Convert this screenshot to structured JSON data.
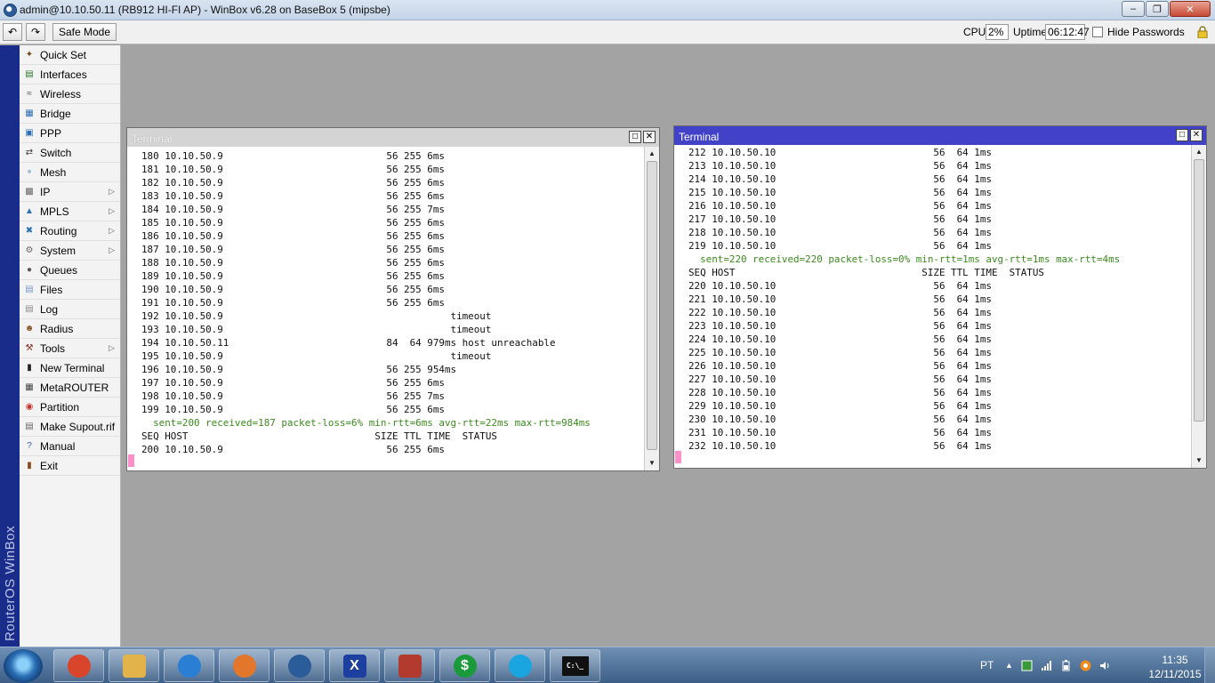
{
  "window": {
    "title": "admin@10.10.50.11 (RB912 HI-FI AP) - WinBox v6.28 on BaseBox 5 (mipsbe)"
  },
  "toolbar": {
    "safe_mode_label": "Safe Mode",
    "cpu_label": "CPU:",
    "cpu_value": "2%",
    "uptime_label": "Uptime:",
    "uptime_value": "06:12:47",
    "hide_passwords_label": "Hide Passwords"
  },
  "brand": "RouterOS WinBox",
  "menu": [
    {
      "label": "Quick Set",
      "icon": "wand-icon",
      "submenu": false
    },
    {
      "label": "Interfaces",
      "icon": "interfaces-icon",
      "submenu": false
    },
    {
      "label": "Wireless",
      "icon": "wireless-icon",
      "submenu": false
    },
    {
      "label": "Bridge",
      "icon": "bridge-icon",
      "submenu": false
    },
    {
      "label": "PPP",
      "icon": "ppp-icon",
      "submenu": false
    },
    {
      "label": "Switch",
      "icon": "switch-icon",
      "submenu": false
    },
    {
      "label": "Mesh",
      "icon": "mesh-icon",
      "submenu": false
    },
    {
      "label": "IP",
      "icon": "ip-icon",
      "submenu": true
    },
    {
      "label": "MPLS",
      "icon": "mpls-icon",
      "submenu": true
    },
    {
      "label": "Routing",
      "icon": "routing-icon",
      "submenu": true
    },
    {
      "label": "System",
      "icon": "gear-icon",
      "submenu": true
    },
    {
      "label": "Queues",
      "icon": "queues-icon",
      "submenu": false
    },
    {
      "label": "Files",
      "icon": "folder-icon",
      "submenu": false
    },
    {
      "label": "Log",
      "icon": "log-icon",
      "submenu": false
    },
    {
      "label": "Radius",
      "icon": "radius-icon",
      "submenu": false
    },
    {
      "label": "Tools",
      "icon": "tools-icon",
      "submenu": true
    },
    {
      "label": "New Terminal",
      "icon": "terminal-icon",
      "submenu": false
    },
    {
      "label": "MetaROUTER",
      "icon": "metarouter-icon",
      "submenu": false
    },
    {
      "label": "Partition",
      "icon": "partition-icon",
      "submenu": false
    },
    {
      "label": "Make Supout.rif",
      "icon": "document-icon",
      "submenu": false
    },
    {
      "label": "Manual",
      "icon": "help-icon",
      "submenu": false
    },
    {
      "label": "Exit",
      "icon": "exit-icon",
      "submenu": false
    }
  ],
  "terminals": [
    {
      "title": "Terminal",
      "lines": [
        {
          "text": "180 10.10.50.9                            56 255 6ms",
          "type": "row"
        },
        {
          "text": "181 10.10.50.9                            56 255 6ms",
          "type": "row"
        },
        {
          "text": "182 10.10.50.9                            56 255 6ms",
          "type": "row"
        },
        {
          "text": "183 10.10.50.9                            56 255 6ms",
          "type": "row"
        },
        {
          "text": "184 10.10.50.9                            56 255 7ms",
          "type": "row"
        },
        {
          "text": "185 10.10.50.9                            56 255 6ms",
          "type": "row"
        },
        {
          "text": "186 10.10.50.9                            56 255 6ms",
          "type": "row"
        },
        {
          "text": "187 10.10.50.9                            56 255 6ms",
          "type": "row"
        },
        {
          "text": "188 10.10.50.9                            56 255 6ms",
          "type": "row"
        },
        {
          "text": "189 10.10.50.9                            56 255 6ms",
          "type": "row"
        },
        {
          "text": "190 10.10.50.9                            56 255 6ms",
          "type": "row"
        },
        {
          "text": "191 10.10.50.9                            56 255 6ms",
          "type": "row"
        },
        {
          "text": "192 10.10.50.9                                       timeout",
          "type": "row"
        },
        {
          "text": "193 10.10.50.9                                       timeout",
          "type": "row"
        },
        {
          "text": "194 10.10.50.11                           84  64 979ms host unreachable",
          "type": "row"
        },
        {
          "text": "195 10.10.50.9                                       timeout",
          "type": "row"
        },
        {
          "text": "196 10.10.50.9                            56 255 954ms",
          "type": "row"
        },
        {
          "text": "197 10.10.50.9                            56 255 6ms",
          "type": "row"
        },
        {
          "text": "198 10.10.50.9                            56 255 7ms",
          "type": "row"
        },
        {
          "text": "199 10.10.50.9                            56 255 6ms",
          "type": "row"
        },
        {
          "text": "  sent=200 received=187 packet-loss=6% min-rtt=6ms avg-rtt=22ms max-rtt=984ms",
          "type": "stat"
        },
        {
          "text": "SEQ HOST                                SIZE TTL TIME  STATUS",
          "type": "row"
        },
        {
          "text": "200 10.10.50.9                            56 255 6ms",
          "type": "row"
        }
      ]
    },
    {
      "title": "Terminal",
      "lines": [
        {
          "text": "212 10.10.50.10                           56  64 1ms",
          "type": "row"
        },
        {
          "text": "213 10.10.50.10                           56  64 1ms",
          "type": "row"
        },
        {
          "text": "214 10.10.50.10                           56  64 1ms",
          "type": "row"
        },
        {
          "text": "215 10.10.50.10                           56  64 1ms",
          "type": "row"
        },
        {
          "text": "216 10.10.50.10                           56  64 1ms",
          "type": "row"
        },
        {
          "text": "217 10.10.50.10                           56  64 1ms",
          "type": "row"
        },
        {
          "text": "218 10.10.50.10                           56  64 1ms",
          "type": "row"
        },
        {
          "text": "219 10.10.50.10                           56  64 1ms",
          "type": "row"
        },
        {
          "text": "  sent=220 received=220 packet-loss=0% min-rtt=1ms avg-rtt=1ms max-rtt=4ms",
          "type": "stat"
        },
        {
          "text": "SEQ HOST                                SIZE TTL TIME  STATUS",
          "type": "row"
        },
        {
          "text": "220 10.10.50.10                           56  64 1ms",
          "type": "row"
        },
        {
          "text": "221 10.10.50.10                           56  64 1ms",
          "type": "row"
        },
        {
          "text": "222 10.10.50.10                           56  64 1ms",
          "type": "row"
        },
        {
          "text": "223 10.10.50.10                           56  64 1ms",
          "type": "row"
        },
        {
          "text": "224 10.10.50.10                           56  64 1ms",
          "type": "row"
        },
        {
          "text": "225 10.10.50.10                           56  64 1ms",
          "type": "row"
        },
        {
          "text": "226 10.10.50.10                           56  64 1ms",
          "type": "row"
        },
        {
          "text": "227 10.10.50.10                           56  64 1ms",
          "type": "row"
        },
        {
          "text": "228 10.10.50.10                           56  64 1ms",
          "type": "row"
        },
        {
          "text": "229 10.10.50.10                           56  64 1ms",
          "type": "row"
        },
        {
          "text": "230 10.10.50.10                           56  64 1ms",
          "type": "row"
        },
        {
          "text": "231 10.10.50.10                           56  64 1ms",
          "type": "row"
        },
        {
          "text": "232 10.10.50.10                           56  64 1ms",
          "type": "row"
        }
      ]
    }
  ],
  "taskbar": {
    "apps": [
      {
        "name": "chrome-icon",
        "color": "#d8452b"
      },
      {
        "name": "file-explorer-icon",
        "color": "#e2b34a"
      },
      {
        "name": "internet-explorer-icon",
        "color": "#2a7fd4"
      },
      {
        "name": "firefox-icon",
        "color": "#e2762a"
      },
      {
        "name": "winbox-icon",
        "color": "#2b5c9a"
      },
      {
        "name": "x-app-icon",
        "color": "#1c3fa0"
      },
      {
        "name": "wrench-app-icon",
        "color": "#b23a2e"
      },
      {
        "name": "dollar-app-icon",
        "color": "#1a9a3a"
      },
      {
        "name": "skype-icon",
        "color": "#1ba5e0"
      },
      {
        "name": "command-prompt-icon",
        "color": "#111111"
      }
    ],
    "dollar_symbol": "$",
    "x_symbol": "X",
    "cmd_symbol": "C:\\_",
    "language": "PT",
    "time": "11:35",
    "date": "12/11/2015"
  }
}
